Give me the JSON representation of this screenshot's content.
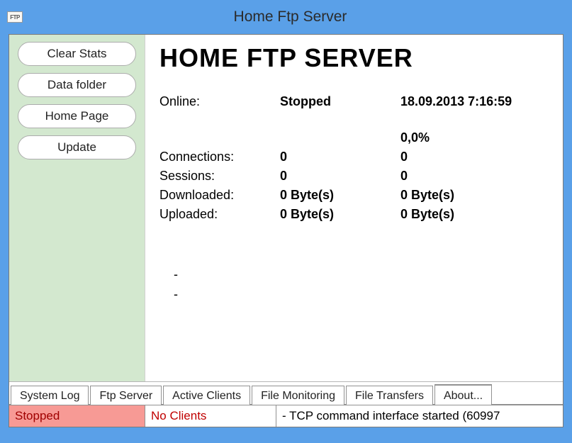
{
  "titlebar": {
    "icon_text": "FTP",
    "title": "Home Ftp Server"
  },
  "sidebar": {
    "buttons": {
      "clear_stats": "Clear Stats",
      "data_folder": "Data folder",
      "home_page": "Home Page",
      "update": "Update"
    }
  },
  "main": {
    "heading": "HOME FTP SERVER",
    "rows": {
      "online_label": "Online:",
      "online_value": "Stopped",
      "online_timestamp": "18.09.2013 7:16:59",
      "percent": "0,0%",
      "connections_label": "Connections:",
      "connections_val": "0",
      "connections_r": "0",
      "sessions_label": "Sessions:",
      "sessions_val": "0",
      "sessions_r": "0",
      "downloaded_label": "Downloaded:",
      "downloaded_val": "0 Byte(s)",
      "downloaded_r": "0 Byte(s)",
      "uploaded_label": "Uploaded:",
      "uploaded_val": "0 Byte(s)",
      "uploaded_r": "0 Byte(s)"
    },
    "dash1": "-",
    "dash2": "-"
  },
  "tabs": {
    "system_log": "System Log",
    "ftp_server": "Ftp Server",
    "active_clients": "Active Clients",
    "file_monitoring": "File Monitoring",
    "file_transfers": "File Transfers",
    "about": "About..."
  },
  "status": {
    "stopped": "Stopped",
    "clients": "No Clients",
    "log": "- TCP command interface started (60997"
  }
}
